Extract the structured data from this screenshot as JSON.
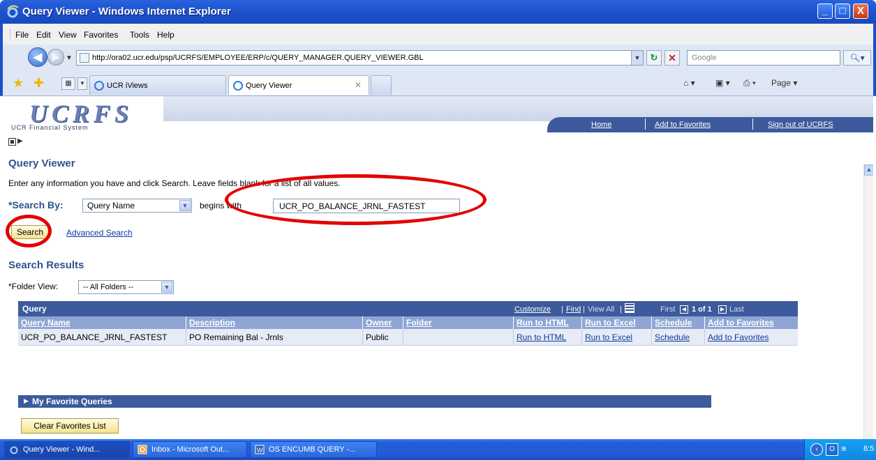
{
  "window": {
    "title": "Query Viewer - Windows Internet Explorer",
    "minimize_glyph": "_",
    "maximize_glyph": "□",
    "close_glyph": "X"
  },
  "menu": {
    "items": [
      "File",
      "Edit",
      "View",
      "Favorites",
      "Tools",
      "Help"
    ]
  },
  "address": {
    "url": "http://ora02.ucr.edu/psp/UCRFS/EMPLOYEE/ERP/c/QUERY_MANAGER.QUERY_VIEWER.GBL",
    "search_placeholder": "Google"
  },
  "tabs": [
    {
      "label": "UCR iViews",
      "active": false
    },
    {
      "label": "Query Viewer",
      "active": true
    }
  ],
  "command_bar": {
    "page_label": "Page ▾"
  },
  "header": {
    "logo": "UCRFS",
    "logo_subtitle": "UCR Financial System",
    "links": [
      "Home",
      "Add to Favorites",
      "Sign out of UCRFS"
    ]
  },
  "page": {
    "title": "Query Viewer",
    "instructions": "Enter any information you have and click Search. Leave fields blank for a list of all values.",
    "search_by_label": "*Search By:",
    "search_by_value": "Query Name",
    "operator_label": "begins with",
    "query_value": "UCR_PO_BALANCE_JRNL_FASTEST",
    "search_button": "Search",
    "advanced_search": "Advanced Search",
    "results_title": "Search Results",
    "folder_view_label": "*Folder View:",
    "folder_view_value": "-- All Folders --"
  },
  "grid": {
    "title": "Query",
    "nav": {
      "customize": "Customize",
      "find": "Find",
      "view_all": "View All",
      "first": "First",
      "position": "1 of 1",
      "last": "Last"
    },
    "columns": [
      "Query Name",
      "Description",
      "Owner",
      "Folder",
      "Run to HTML",
      "Run to Excel",
      "Schedule",
      "Add to Favorites"
    ],
    "rows": [
      {
        "query_name": "UCR_PO_BALANCE_JRNL_FASTEST",
        "description": "PO Remaining Bal - Jrnls",
        "owner": "Public",
        "folder": "",
        "run_html": "Run to HTML",
        "run_excel": "Run to Excel",
        "schedule": "Schedule",
        "add_fav": "Add to Favorites"
      }
    ]
  },
  "favorites": {
    "section_title": "My Favorite Queries",
    "clear_button": "Clear Favorites List"
  },
  "taskbar": {
    "tasks": [
      "Query Viewer - Wind...",
      "Inbox - Microsoft Out...",
      "OS ENCUMB QUERY -..."
    ],
    "clock": "8:5"
  },
  "colors": {
    "title_blue": "#31528b",
    "grid_header": "#3c5a9c",
    "link": "#0f3a9c",
    "annotation_red": "#e30000"
  }
}
